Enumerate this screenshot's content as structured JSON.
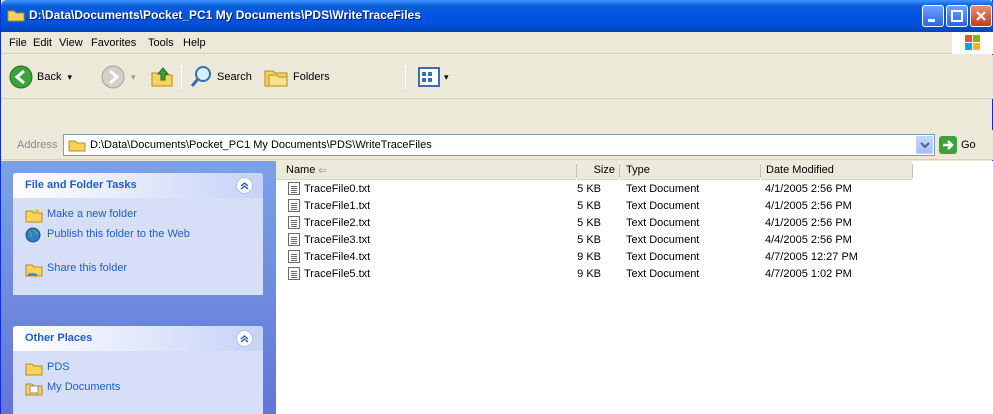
{
  "window": {
    "title": "D:\\Data\\Documents\\Pocket_PC1 My Documents\\PDS\\WriteTraceFiles"
  },
  "menu": [
    "File",
    "Edit",
    "View",
    "Favorites",
    "Tools",
    "Help"
  ],
  "toolbar": {
    "back_label": "Back",
    "search_label": "Search",
    "folders_label": "Folders"
  },
  "address": {
    "label": "Address",
    "value": "D:\\Data\\Documents\\Pocket_PC1 My Documents\\PDS\\WriteTraceFiles",
    "go_label": "Go"
  },
  "tasks_panel": {
    "title": "File and Folder Tasks",
    "items": [
      {
        "label": "Make a new folder",
        "icon": "new-folder-icon"
      },
      {
        "label": "Publish this folder to the Web",
        "icon": "globe-icon"
      },
      {
        "label": "Share this folder",
        "icon": "share-folder-icon"
      }
    ]
  },
  "places_panel": {
    "title": "Other Places",
    "items": [
      {
        "label": "PDS",
        "icon": "folder-icon"
      },
      {
        "label": "My Documents",
        "icon": "my-documents-icon"
      }
    ]
  },
  "columns": {
    "name": "Name",
    "size": "Size",
    "type": "Type",
    "date": "Date Modified"
  },
  "files": [
    {
      "name": "TraceFile0.txt",
      "size": "5 KB",
      "type": "Text Document",
      "date": "4/1/2005 2:56 PM"
    },
    {
      "name": "TraceFile1.txt",
      "size": "5 KB",
      "type": "Text Document",
      "date": "4/1/2005 2:56 PM"
    },
    {
      "name": "TraceFile2.txt",
      "size": "5 KB",
      "type": "Text Document",
      "date": "4/1/2005 2:56 PM"
    },
    {
      "name": "TraceFile3.txt",
      "size": "5 KB",
      "type": "Text Document",
      "date": "4/4/2005 2:56 PM"
    },
    {
      "name": "TraceFile4.txt",
      "size": "9 KB",
      "type": "Text Document",
      "date": "4/7/2005 12:27 PM"
    },
    {
      "name": "TraceFile5.txt",
      "size": "9 KB",
      "type": "Text Document",
      "date": "4/7/2005 1:02 PM"
    }
  ],
  "colors": {
    "titlebar": "#0054e3",
    "taskpane": "#6e8fe0",
    "link": "#215dc6"
  }
}
